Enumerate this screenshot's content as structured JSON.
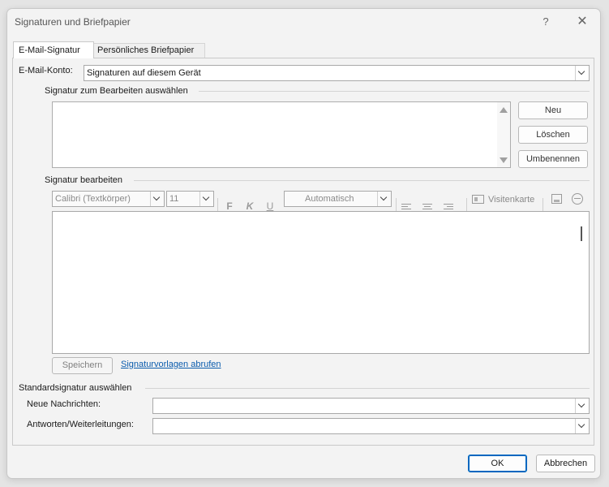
{
  "window": {
    "title": "Signaturen und Briefpapier",
    "help_label": "?",
    "close_label": "✕"
  },
  "tabs": [
    {
      "label": "E-Mail-Signatur",
      "active": true
    },
    {
      "label": "Persönliches Briefpapier",
      "active": false
    }
  ],
  "account": {
    "label": "E-Mail-Konto:",
    "value": "Signaturen auf diesem Gerät"
  },
  "select_signature": {
    "heading": "Signatur zum Bearbeiten auswählen",
    "buttons": {
      "new": "Neu",
      "delete": "Löschen",
      "rename": "Umbenennen"
    }
  },
  "edit_signature": {
    "heading": "Signatur bearbeiten",
    "font": "Calibri (Textkörper)",
    "size": "11",
    "bold": "F",
    "italic": "K",
    "underline": "U",
    "color": "Automatisch",
    "business_card": "Visitenkarte"
  },
  "save_label": "Speichern",
  "templates_link": "Signaturvorlagen abrufen",
  "default_signature": {
    "heading": "Standardsignatur auswählen",
    "new_messages_label": "Neue Nachrichten:",
    "new_messages_value": "",
    "replies_label": "Antworten/Weiterleitungen:",
    "replies_value": ""
  },
  "footer": {
    "ok": "OK",
    "cancel": "Abbrechen"
  },
  "colors": {
    "accent": "#0067c0",
    "link": "#0b5cad"
  }
}
